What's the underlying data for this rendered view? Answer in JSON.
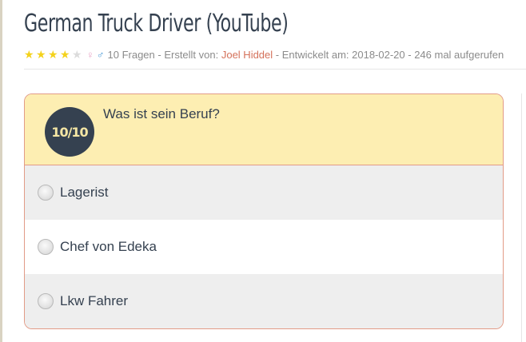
{
  "quiz": {
    "title": "German Truck Driver (YouTube)",
    "rating": {
      "value": 4,
      "max": 5
    },
    "gender_female_icon": "♀",
    "gender_male_icon": "♂",
    "meta_questions": "10 Fragen",
    "meta_created_prefix": " - Erstellt von: ",
    "meta_author": "Joel Hiddel",
    "meta_rest": " - Entwickelt am: 2018-02-20 - 246 mal aufgerufen"
  },
  "question": {
    "counter": "10/10",
    "text": "Was ist sein Beruf?",
    "answers": [
      {
        "label": "Lagerist"
      },
      {
        "label": "Chef von Edeka"
      },
      {
        "label": "Lkw Fahrer"
      }
    ]
  },
  "colors": {
    "title": "#354150",
    "star": "#f4d21b",
    "author_link": "#d4715a",
    "card_border": "#e29b87",
    "question_bg": "#fdeeb2",
    "badge_bg": "#354150"
  }
}
